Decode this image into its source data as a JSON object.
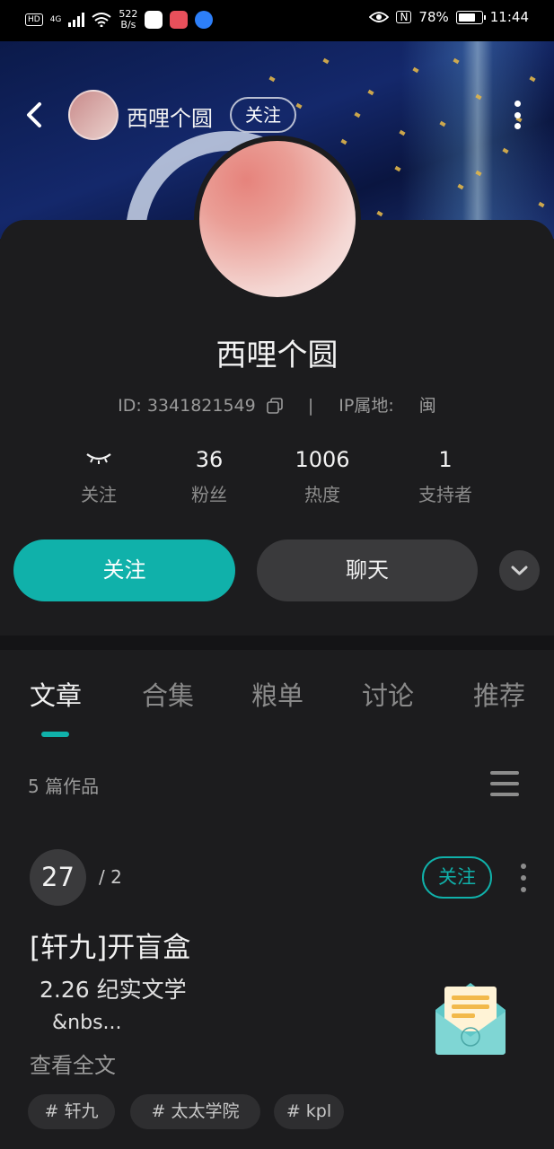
{
  "status_bar": {
    "hd": "HD",
    "network": "4G",
    "speed_value": "522",
    "speed_unit": "B/s",
    "nfc": "N",
    "battery": "78%",
    "battery_level": 0.78,
    "time": "11:44"
  },
  "header": {
    "nickname": "西哩个圆",
    "follow_label": "关注"
  },
  "profile": {
    "name": "西哩个圆",
    "id_label": "ID: 3341821549",
    "separator": "|",
    "ip_label": "IP属地:",
    "ip_value": "闽",
    "stats": [
      {
        "value": "︶︶",
        "label": "关注"
      },
      {
        "value": "36",
        "label": "粉丝"
      },
      {
        "value": "1006",
        "label": "热度"
      },
      {
        "value": "1",
        "label": "支持者"
      }
    ],
    "follow_button": "关注",
    "chat_button": "聊天"
  },
  "tabs": [
    {
      "label": "文章",
      "active": true
    },
    {
      "label": "合集",
      "active": false
    },
    {
      "label": "粮单",
      "active": false
    },
    {
      "label": "讨论",
      "active": false
    },
    {
      "label": "推荐",
      "active": false
    }
  ],
  "works_count": "5 篇作品",
  "article": {
    "number": "27",
    "total": "/ 2",
    "follow_label": "关注",
    "title": "[轩九]开盲盒",
    "line1": "2.26 纪实文学",
    "line2": "&nbs...",
    "read_more": "查看全文",
    "tags": [
      "# 轩九",
      "# 太太学院",
      "# kpl"
    ]
  },
  "colors": {
    "accent": "#10b1aa",
    "background": "#1c1c1e",
    "button_dark": "#3a3a3c"
  }
}
